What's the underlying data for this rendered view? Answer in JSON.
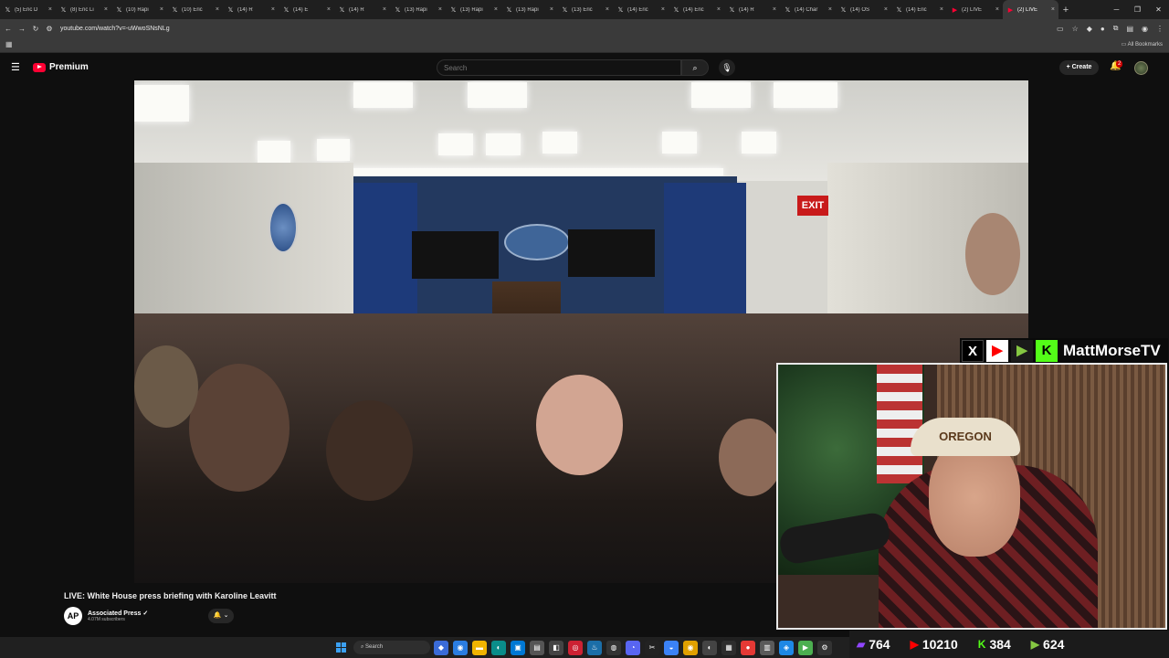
{
  "browser": {
    "tabs": [
      {
        "icon": "x-icon",
        "title": "(5) Eric D"
      },
      {
        "icon": "x-icon",
        "title": "(8) Eric Li"
      },
      {
        "icon": "x-icon",
        "title": "(10) Rapi"
      },
      {
        "icon": "x-icon",
        "title": "(10) Eric"
      },
      {
        "icon": "x-icon",
        "title": "(14) R"
      },
      {
        "icon": "x-icon",
        "title": "(14) E"
      },
      {
        "icon": "x-icon",
        "title": "(14) R"
      },
      {
        "icon": "x-icon",
        "title": "(13) Rapi"
      },
      {
        "icon": "x-icon",
        "title": "(13) Rapi"
      },
      {
        "icon": "x-icon",
        "title": "(13) Rapi"
      },
      {
        "icon": "x-icon",
        "title": "(13) Eric"
      },
      {
        "icon": "x-icon",
        "title": "(14) Eric"
      },
      {
        "icon": "x-icon",
        "title": "(14) Eric"
      },
      {
        "icon": "x-icon",
        "title": "(14) R"
      },
      {
        "icon": "x-icon",
        "title": "(14) Char"
      },
      {
        "icon": "x-icon",
        "title": "(14) OS"
      },
      {
        "icon": "x-icon",
        "title": "(14) Eric"
      },
      {
        "icon": "youtube-icon",
        "title": "(2) LIVE"
      },
      {
        "icon": "youtube-icon",
        "title": "(2) LIVE",
        "active": true
      }
    ],
    "url": "youtube.com/watch?v=-uWwoSNsNLg",
    "bookmarks_label": "All Bookmarks"
  },
  "youtube": {
    "brand": "Premium",
    "search_placeholder": "Search",
    "create_label": "Create",
    "notification_count": "2"
  },
  "video": {
    "exit_sign": "EXIT",
    "title": "LIVE: White House press briefing with Karoline Leavitt",
    "channel": "Associated Press",
    "channel_logo": "AP",
    "subscribers": "4.07M subscribers"
  },
  "overlay": {
    "brand": "MattMorseTV",
    "cap_text": "OREGON",
    "stats": [
      {
        "icon": "twitch-icon",
        "color": "#9146ff",
        "value": "764"
      },
      {
        "icon": "youtube-icon",
        "color": "#ff0000",
        "value": "10210"
      },
      {
        "icon": "kick-icon",
        "color": "#53fc18",
        "value": "384"
      },
      {
        "icon": "rumble-icon",
        "color": "#85c742",
        "value": "624"
      }
    ]
  },
  "taskbar": {
    "search_label": "Search"
  }
}
